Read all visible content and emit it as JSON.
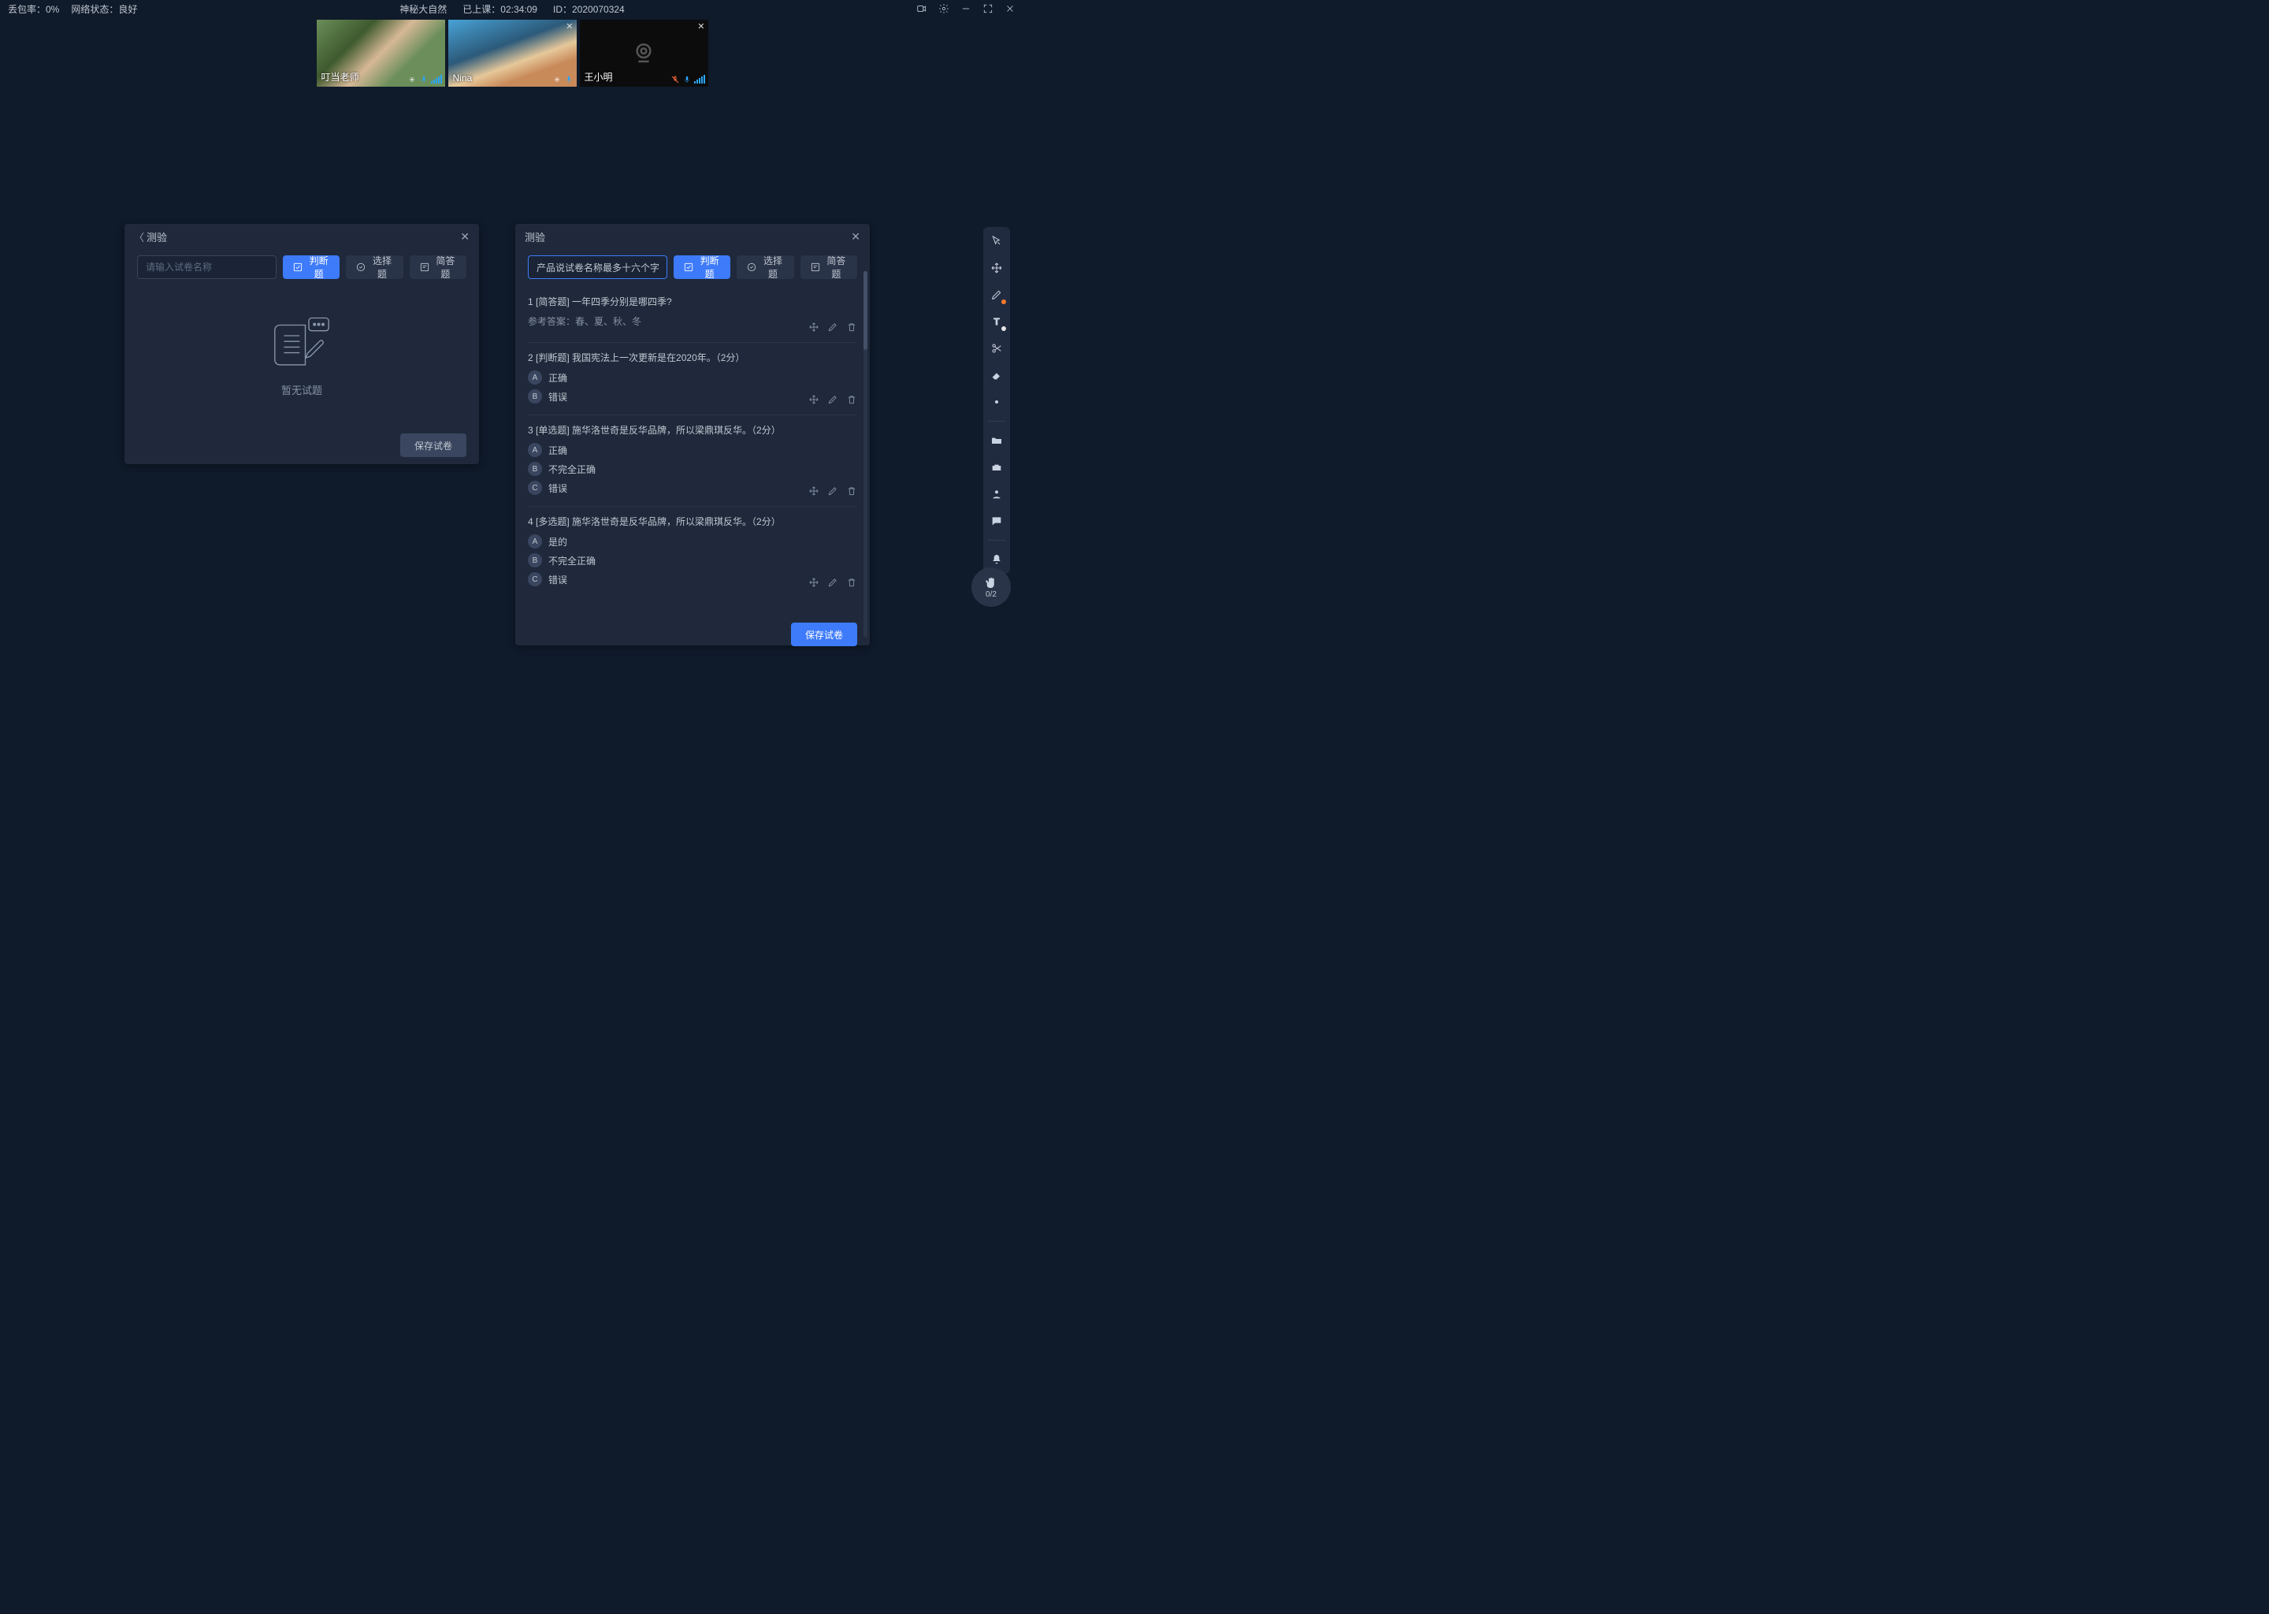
{
  "topbar": {
    "packet_loss_label": "丢包率：0%",
    "network_label": "网络状态：良好",
    "course_title": "神秘大自然",
    "elapsed": "已上课：02:34:09",
    "session_id": "ID：2020070324"
  },
  "participants": [
    {
      "name": "叮当老师",
      "camera": true,
      "mic": true,
      "closable": false
    },
    {
      "name": "Nina",
      "camera": true,
      "mic": true,
      "closable": true
    },
    {
      "name": "王小明",
      "camera": false,
      "mic": true,
      "closable": true
    }
  ],
  "quiz_left": {
    "title": "测验",
    "input_placeholder": "请输入试卷名称",
    "btn_judge": "判断题",
    "btn_choice": "选择题",
    "btn_short": "简答题",
    "empty_text": "暂无试题",
    "save_btn": "保存试卷"
  },
  "quiz_right": {
    "title": "测验",
    "quiz_name_value": "产品说试卷名称最多十六个字",
    "btn_judge": "判断题",
    "btn_choice": "选择题",
    "btn_short": "简答题",
    "save_btn": "保存试卷",
    "questions": [
      {
        "idx": "1",
        "tag": "[简答题]",
        "text": "一年四季分别是哪四季?",
        "answer_label": "参考答案：春、夏、秋、冬",
        "options": []
      },
      {
        "idx": "2",
        "tag": "[判断题]",
        "text": "我国宪法上一次更新是在2020年。（2分）",
        "answer_label": "",
        "options": [
          {
            "letter": "A",
            "text": "正确"
          },
          {
            "letter": "B",
            "text": "错误"
          }
        ]
      },
      {
        "idx": "3",
        "tag": "[单选题]",
        "text": "施华洛世奇是反华品牌，所以梁鼎琪反华。（2分）",
        "answer_label": "",
        "options": [
          {
            "letter": "A",
            "text": "正确"
          },
          {
            "letter": "B",
            "text": "不完全正确"
          },
          {
            "letter": "C",
            "text": "错误"
          }
        ]
      },
      {
        "idx": "4",
        "tag": "[多选题]",
        "text": "施华洛世奇是反华品牌，所以梁鼎琪反华。（2分）",
        "answer_label": "",
        "options": [
          {
            "letter": "A",
            "text": "是的"
          },
          {
            "letter": "B",
            "text": "不完全正确"
          },
          {
            "letter": "C",
            "text": "错误"
          }
        ]
      }
    ]
  },
  "hand_raise": {
    "count": "0/2"
  },
  "tool_names": {
    "cursor": "cursor-icon",
    "move": "move-icon",
    "pen": "pen-icon",
    "text": "text-icon",
    "scissors": "scissors-icon",
    "eraser": "eraser-icon",
    "dot": "dot-icon",
    "folder": "folder-icon",
    "toolbox": "toolbox-icon",
    "person": "person-icon",
    "chat": "chat-icon",
    "bell": "bell-icon"
  }
}
